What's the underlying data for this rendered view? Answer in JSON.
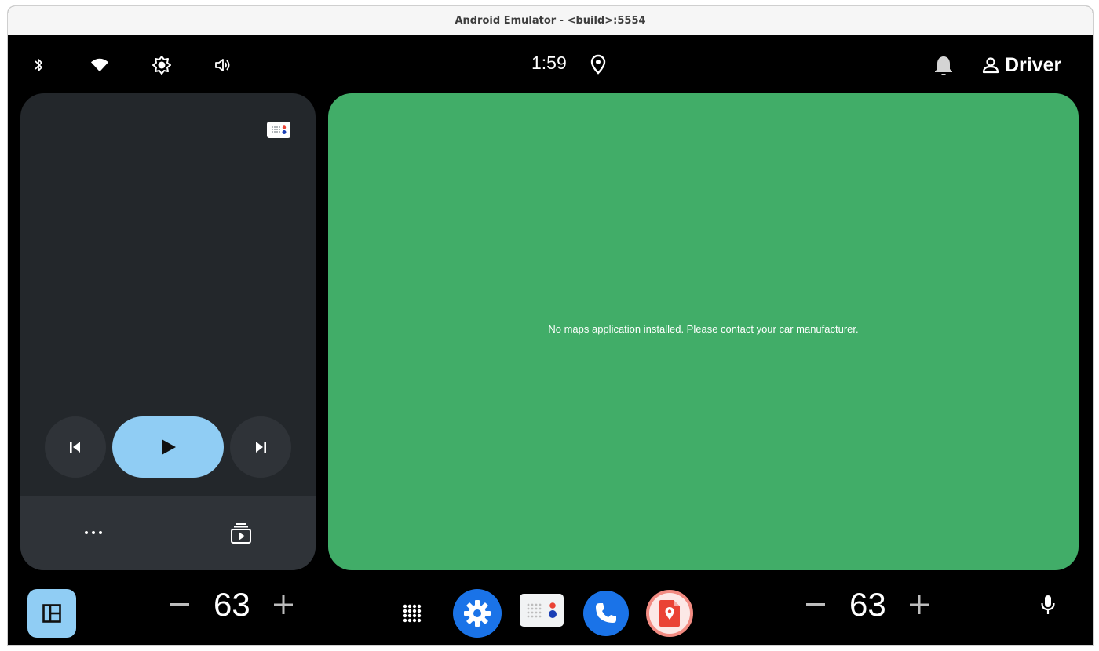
{
  "window": {
    "title": "Android Emulator - <build>:5554"
  },
  "status_bar": {
    "icons": [
      "bluetooth-icon",
      "wifi-icon",
      "brightness-icon",
      "volume-icon"
    ],
    "clock": "1:59",
    "location_icon": "location-pin-icon",
    "notification_icon": "bell-icon",
    "user_label": "Driver"
  },
  "media": {
    "app_icon": "media-source-icon",
    "controls": [
      "skip-previous",
      "play",
      "skip-next"
    ],
    "play_color": "#90cdf4",
    "bottom_actions": [
      "more",
      "queue"
    ]
  },
  "map": {
    "message": "No maps application installed. Please contact your car manufacturer.",
    "background": "#41ad68"
  },
  "dock": {
    "left_temp": "63",
    "right_temp": "63",
    "minus_symbol": "−",
    "plus_symbol": "+",
    "apps": [
      "app-grid",
      "settings",
      "radio",
      "phone",
      "maps"
    ],
    "accent": "#1a73e8"
  }
}
